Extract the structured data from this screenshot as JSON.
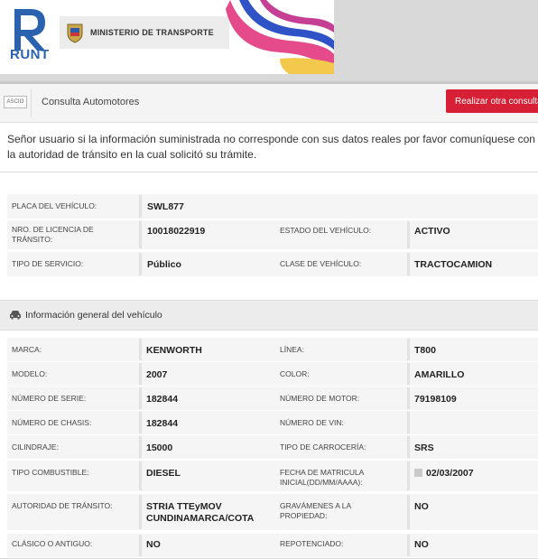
{
  "header": {
    "logo_text": "RUNT",
    "ministry": "MINISTERIO DE TRANSPORTE"
  },
  "toolbar": {
    "icon_text": "ASCII3",
    "title": "Consulta Automotores",
    "button": "Realizar otra consulta"
  },
  "notice": "Señor usuario si la información suministrada no corresponde con sus datos reales por favor comuníquese con la autoridad de tránsito en la cual solicitó su trámite.",
  "summary": {
    "placa_label": "PLACA DEL VEHÍCULO:",
    "placa": "SWL877",
    "licencia_label": "NRO. DE LICENCIA DE TRÁNSITO:",
    "licencia": "10018022919",
    "estado_label": "ESTADO DEL VEHÍCULO:",
    "estado": "ACTIVO",
    "servicio_label": "TIPO DE SERVICIO:",
    "servicio": "Público",
    "clase_label": "CLASE DE VEHÍCULO:",
    "clase": "TRACTOCAMION"
  },
  "section_title": "Información general del vehículo",
  "general": {
    "marca_label": "MARCA:",
    "marca": "KENWORTH",
    "linea_label": "LÍNEA:",
    "linea": "T800",
    "modelo_label": "MODELO:",
    "modelo": "2007",
    "color_label": "COLOR:",
    "color": "AMARILLO",
    "serie_label": "NÚMERO DE SERIE:",
    "serie": "182844",
    "motor_label": "NÚMERO DE MOTOR:",
    "motor": "79198109",
    "chasis_label": "NÚMERO DE CHASIS:",
    "chasis": "182844",
    "vin_label": "NÚMERO DE VIN:",
    "vin": "",
    "cilindraje_label": "CILINDRAJE:",
    "cilindraje": "15000",
    "carroceria_label": "TIPO DE CARROCERÍA:",
    "carroceria": "SRS",
    "combustible_label": "TIPO COMBUSTIBLE:",
    "combustible": "DIESEL",
    "matricula_label": "FECHA DE MATRICULA INICIAL(DD/MM/AAAA):",
    "matricula": "02/03/2007",
    "autoridad_label": "AUTORIDAD DE TRÁNSITO:",
    "autoridad": "STRIA TTEyMOV CUNDINAMARCA/COTA",
    "gravamenes_label": "GRAVÁMENES A LA PROPIEDAD:",
    "gravamenes": "NO",
    "clasico_label": "CLÁSICO O ANTIGUO:",
    "clasico": "NO",
    "repotenciado_label": "REPOTENCIADO:",
    "repotenciado": "NO"
  }
}
